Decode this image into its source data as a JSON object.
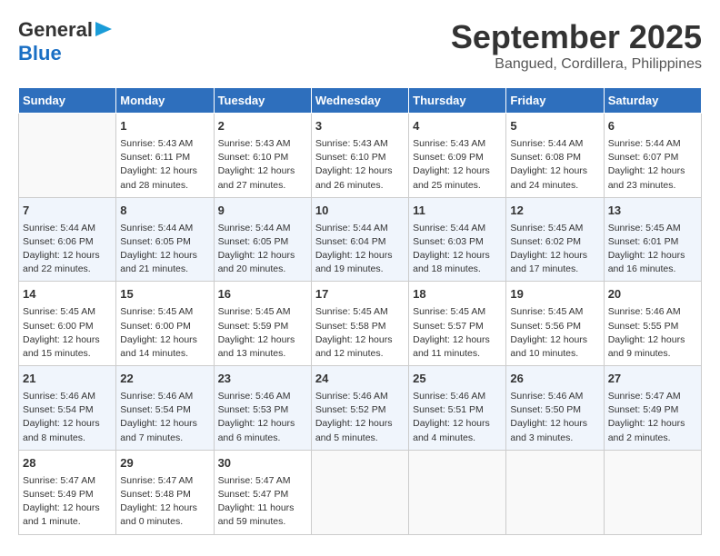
{
  "header": {
    "logo_line1": "General",
    "logo_line2": "Blue",
    "month_year": "September 2025",
    "subtitle": "Bangued, Cordillera, Philippines"
  },
  "weekdays": [
    "Sunday",
    "Monday",
    "Tuesday",
    "Wednesday",
    "Thursday",
    "Friday",
    "Saturday"
  ],
  "weeks": [
    [
      {
        "day": "",
        "text": ""
      },
      {
        "day": "1",
        "text": "Sunrise: 5:43 AM\nSunset: 6:11 PM\nDaylight: 12 hours\nand 28 minutes."
      },
      {
        "day": "2",
        "text": "Sunrise: 5:43 AM\nSunset: 6:10 PM\nDaylight: 12 hours\nand 27 minutes."
      },
      {
        "day": "3",
        "text": "Sunrise: 5:43 AM\nSunset: 6:10 PM\nDaylight: 12 hours\nand 26 minutes."
      },
      {
        "day": "4",
        "text": "Sunrise: 5:43 AM\nSunset: 6:09 PM\nDaylight: 12 hours\nand 25 minutes."
      },
      {
        "day": "5",
        "text": "Sunrise: 5:44 AM\nSunset: 6:08 PM\nDaylight: 12 hours\nand 24 minutes."
      },
      {
        "day": "6",
        "text": "Sunrise: 5:44 AM\nSunset: 6:07 PM\nDaylight: 12 hours\nand 23 minutes."
      }
    ],
    [
      {
        "day": "7",
        "text": "Sunrise: 5:44 AM\nSunset: 6:06 PM\nDaylight: 12 hours\nand 22 minutes."
      },
      {
        "day": "8",
        "text": "Sunrise: 5:44 AM\nSunset: 6:05 PM\nDaylight: 12 hours\nand 21 minutes."
      },
      {
        "day": "9",
        "text": "Sunrise: 5:44 AM\nSunset: 6:05 PM\nDaylight: 12 hours\nand 20 minutes."
      },
      {
        "day": "10",
        "text": "Sunrise: 5:44 AM\nSunset: 6:04 PM\nDaylight: 12 hours\nand 19 minutes."
      },
      {
        "day": "11",
        "text": "Sunrise: 5:44 AM\nSunset: 6:03 PM\nDaylight: 12 hours\nand 18 minutes."
      },
      {
        "day": "12",
        "text": "Sunrise: 5:45 AM\nSunset: 6:02 PM\nDaylight: 12 hours\nand 17 minutes."
      },
      {
        "day": "13",
        "text": "Sunrise: 5:45 AM\nSunset: 6:01 PM\nDaylight: 12 hours\nand 16 minutes."
      }
    ],
    [
      {
        "day": "14",
        "text": "Sunrise: 5:45 AM\nSunset: 6:00 PM\nDaylight: 12 hours\nand 15 minutes."
      },
      {
        "day": "15",
        "text": "Sunrise: 5:45 AM\nSunset: 6:00 PM\nDaylight: 12 hours\nand 14 minutes."
      },
      {
        "day": "16",
        "text": "Sunrise: 5:45 AM\nSunset: 5:59 PM\nDaylight: 12 hours\nand 13 minutes."
      },
      {
        "day": "17",
        "text": "Sunrise: 5:45 AM\nSunset: 5:58 PM\nDaylight: 12 hours\nand 12 minutes."
      },
      {
        "day": "18",
        "text": "Sunrise: 5:45 AM\nSunset: 5:57 PM\nDaylight: 12 hours\nand 11 minutes."
      },
      {
        "day": "19",
        "text": "Sunrise: 5:45 AM\nSunset: 5:56 PM\nDaylight: 12 hours\nand 10 minutes."
      },
      {
        "day": "20",
        "text": "Sunrise: 5:46 AM\nSunset: 5:55 PM\nDaylight: 12 hours\nand 9 minutes."
      }
    ],
    [
      {
        "day": "21",
        "text": "Sunrise: 5:46 AM\nSunset: 5:54 PM\nDaylight: 12 hours\nand 8 minutes."
      },
      {
        "day": "22",
        "text": "Sunrise: 5:46 AM\nSunset: 5:54 PM\nDaylight: 12 hours\nand 7 minutes."
      },
      {
        "day": "23",
        "text": "Sunrise: 5:46 AM\nSunset: 5:53 PM\nDaylight: 12 hours\nand 6 minutes."
      },
      {
        "day": "24",
        "text": "Sunrise: 5:46 AM\nSunset: 5:52 PM\nDaylight: 12 hours\nand 5 minutes."
      },
      {
        "day": "25",
        "text": "Sunrise: 5:46 AM\nSunset: 5:51 PM\nDaylight: 12 hours\nand 4 minutes."
      },
      {
        "day": "26",
        "text": "Sunrise: 5:46 AM\nSunset: 5:50 PM\nDaylight: 12 hours\nand 3 minutes."
      },
      {
        "day": "27",
        "text": "Sunrise: 5:47 AM\nSunset: 5:49 PM\nDaylight: 12 hours\nand 2 minutes."
      }
    ],
    [
      {
        "day": "28",
        "text": "Sunrise: 5:47 AM\nSunset: 5:49 PM\nDaylight: 12 hours\nand 1 minute."
      },
      {
        "day": "29",
        "text": "Sunrise: 5:47 AM\nSunset: 5:48 PM\nDaylight: 12 hours\nand 0 minutes."
      },
      {
        "day": "30",
        "text": "Sunrise: 5:47 AM\nSunset: 5:47 PM\nDaylight: 11 hours\nand 59 minutes."
      },
      {
        "day": "",
        "text": ""
      },
      {
        "day": "",
        "text": ""
      },
      {
        "day": "",
        "text": ""
      },
      {
        "day": "",
        "text": ""
      }
    ]
  ]
}
